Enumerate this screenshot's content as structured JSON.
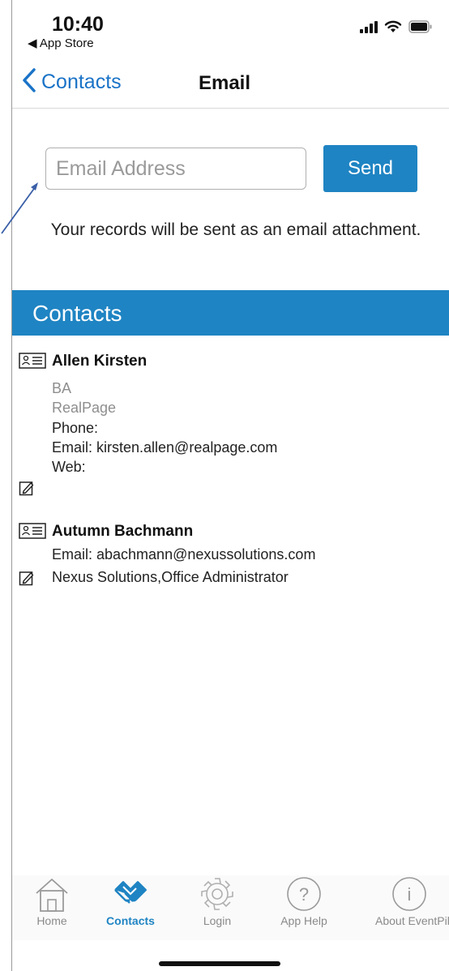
{
  "status_bar": {
    "time": "10:40",
    "back_app": "◀ App Store",
    "icons": [
      "signal-icon",
      "wifi-icon",
      "battery-icon"
    ]
  },
  "nav": {
    "back_label": "Contacts",
    "title": "Email"
  },
  "email_form": {
    "placeholder": "Email Address",
    "value": "",
    "send_label": "Send",
    "info_text": "Your records will be sent as an email attachment."
  },
  "contacts_section": {
    "title": "Contacts"
  },
  "contacts": [
    {
      "name": "Allen Kirsten",
      "title": "BA",
      "company": "RealPage",
      "phone": "Phone:",
      "email": "Email: kirsten.allen@realpage.com",
      "web": "Web:"
    },
    {
      "name": "Autumn Bachmann",
      "email": "Email: abachmann@nexussolutions.com",
      "note": "Nexus Solutions,Office Administrator"
    }
  ],
  "tab_bar": {
    "tabs": [
      {
        "label": "Home",
        "icon": "home-icon",
        "active": false
      },
      {
        "label": "Contacts",
        "icon": "handshake-icon",
        "active": true
      },
      {
        "label": "Login",
        "icon": "gear-icon",
        "active": false
      },
      {
        "label": "App Help",
        "icon": "question-icon",
        "active": false
      },
      {
        "label": "About EventPilot",
        "icon": "info-icon",
        "active": false
      }
    ]
  },
  "colors": {
    "accent": "#1f84c3",
    "link": "#1a73c7",
    "tab_inactive": "#8a8a8a"
  }
}
